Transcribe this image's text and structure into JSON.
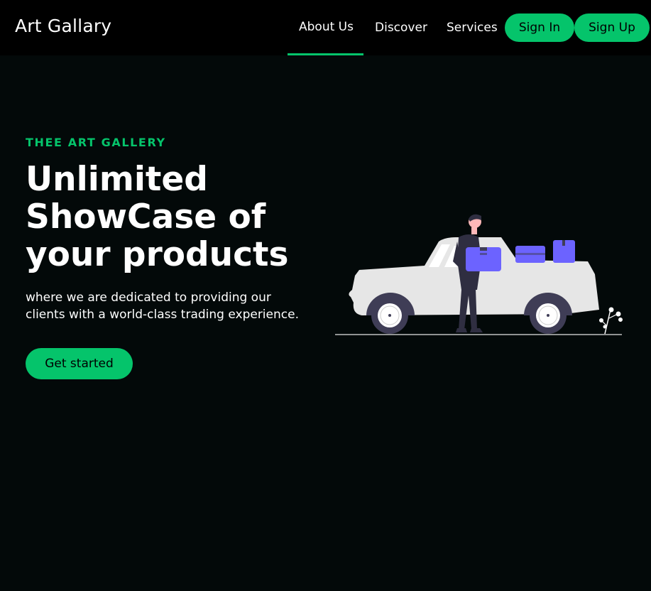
{
  "brand": {
    "name": "Art Gallary"
  },
  "nav": {
    "items": [
      {
        "label": "About Us",
        "active": true
      },
      {
        "label": "Discover",
        "active": false
      },
      {
        "label": "Services",
        "active": false
      }
    ],
    "sign_in": "Sign In",
    "sign_up": "Sign Up"
  },
  "hero": {
    "eyebrow": "THEE ART GALLERY",
    "headline_lines": [
      "Unlimited",
      "ShowCase of",
      "your products"
    ],
    "subtext_lines": [
      "where we are dedicated to providing our",
      "clients with a world-class trading experience."
    ],
    "cta_label": "Get started",
    "illustration_icon": "delivery-car-illustration"
  },
  "colors": {
    "accent": "#05c46b",
    "background": "#030909",
    "topbar": "#000000",
    "box_purple": "#6c63ff",
    "car_body": "#e6e6e6",
    "person_dark": "#2f2e41"
  }
}
